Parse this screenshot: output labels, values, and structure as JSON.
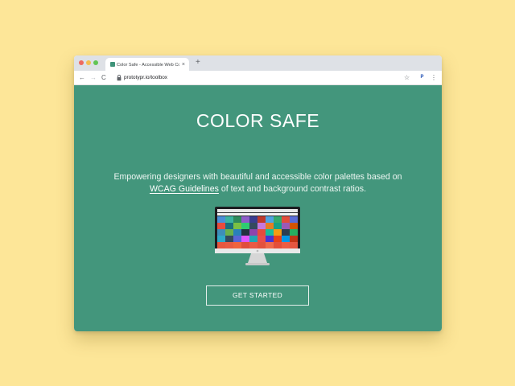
{
  "browser": {
    "tab_title": "Color Safe - Accessible Web Color Combinations",
    "close_glyph": "×",
    "new_tab_glyph": "+",
    "url": "prototypr.io/toolbox",
    "extension_letter": "P",
    "nav": {
      "back": "←",
      "forward": "→",
      "reload": "C"
    },
    "bookmark_glyph": "☆",
    "menu_glyph": "⋮"
  },
  "hero": {
    "title": "COLOR SAFE",
    "subtitle_line1": "Empowering designers with beautiful and accessible color palettes based on",
    "subtitle_link": "WCAG Guidelines",
    "subtitle_line2_rest": " of text and background contrast ratios.",
    "cta_label": "GET STARTED"
  },
  "colors": {
    "background": "#fde698",
    "page": "#43967c",
    "text": "#ffffff"
  }
}
